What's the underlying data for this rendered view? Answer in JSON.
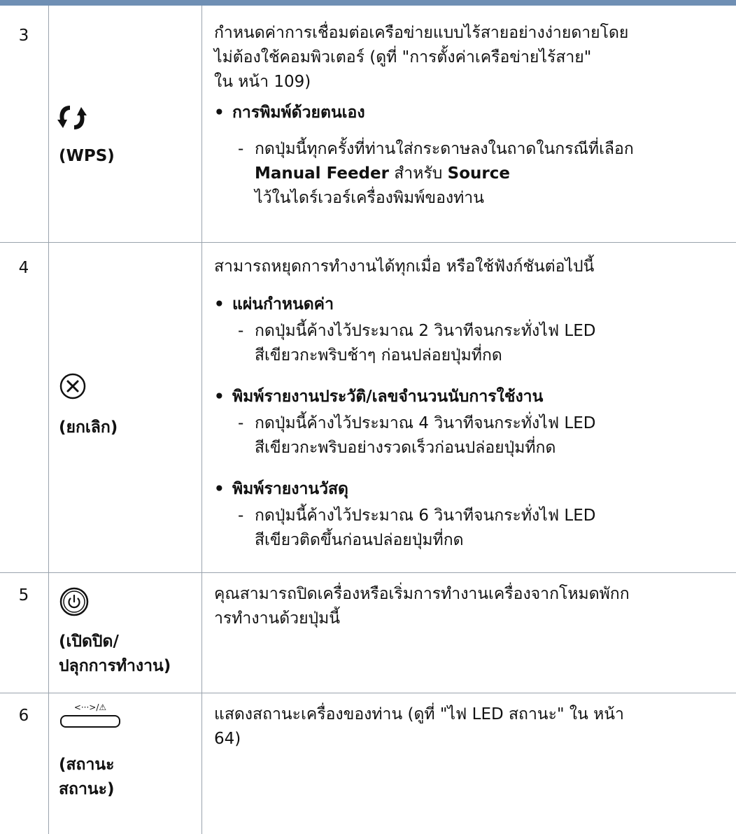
{
  "rows": [
    {
      "num": "3",
      "label": "(WPS)",
      "icon": "wps-icon",
      "desc": "กำหนดค่าการเชื่อมต่อเครือข่ายแบบไร้สายอย่างง่ายดายโดยไม่ต้องใช้คอมพิวเตอร์ (ดูที่ \"การตั้งค่าเครือข่ายไร้สาย\" ใน หน้า 109)",
      "desc_lines": [
        "กำหนดค่าการเชื่อมต่อเครือข่ายแบบไร้สายอย่างง่ายดายโดย",
        "ไม่ต้องใช้คอมพิวเตอร์ (ดูที่ \"การตั้งค่าเครือข่ายไร้สาย\"",
        "ใน หน้า 109)"
      ],
      "bullets": [
        {
          "title": "การพิมพ์ด้วยตนเอง",
          "sub_lines": [
            "กดปุ่มนี้ทุกครั้งที่ท่านใส่กระดาษลงในถาดในกรณีที่เลือก"
          ],
          "sub_l2_bold1": "Manual Feeder",
          "sub_l2_mid": " สำหรับ ",
          "sub_l2_bold2": "Source",
          "sub_l3": "ไว้ในไดร์เวอร์เครื่องพิมพ์ของท่าน"
        }
      ]
    },
    {
      "num": "4",
      "label": "(ยกเลิก)",
      "icon": "cancel-icon",
      "desc": "สามารถหยุดการทำงานได้ทุกเมื่อ หรือใช้ฟังก์ชันต่อไปนี้",
      "bullets": [
        {
          "title": "แผ่นกำหนดค่า",
          "sub": [
            "กดปุ่มนี้ค้างไว้ประมาณ 2 วินาทีจนกระทั่งไฟ LED",
            "สีเขียวกะพริบช้าๆ ก่อนปล่อยปุ่มที่กด"
          ]
        },
        {
          "title": "พิมพ์รายงานประวัติ/เลขจำนวนนับการใช้งาน",
          "sub": [
            "กดปุ่มนี้ค้างไว้ประมาณ 4 วินาทีจนกระทั่งไฟ LED",
            "สีเขียวกะพริบอย่างรวดเร็วก่อนปล่อยปุ่มที่กด"
          ]
        },
        {
          "title": "พิมพ์รายงานวัสดุ",
          "sub": [
            "กดปุ่มนี้ค้างไว้ประมาณ 6 วินาทีจนกระทั่งไฟ LED",
            "สีเขียวติดขึ้นก่อนปล่อยปุ่มที่กด"
          ]
        }
      ]
    },
    {
      "num": "5",
      "label_lines": [
        "(เปิดปิด/",
        "ปลุกการทำงาน)"
      ],
      "icon": "power-icon",
      "desc_lines": [
        "คุณสามารถปิดเครื่องหรือเริ่มการทำงานเครื่องจากโหมดพักก",
        "ารทำงานด้วยปุ่มนี้"
      ]
    },
    {
      "num": "6",
      "label_lines": [
        "(สถานะ",
        "สถานะ)"
      ],
      "icon": "status-led-icon",
      "icon_text": "<···>/⚠",
      "desc_lines": [
        "แสดงสถานะเครื่องของท่าน (ดูที่ \"ไฟ LED สถานะ\"  ใน หน้า",
        "64)"
      ]
    }
  ]
}
